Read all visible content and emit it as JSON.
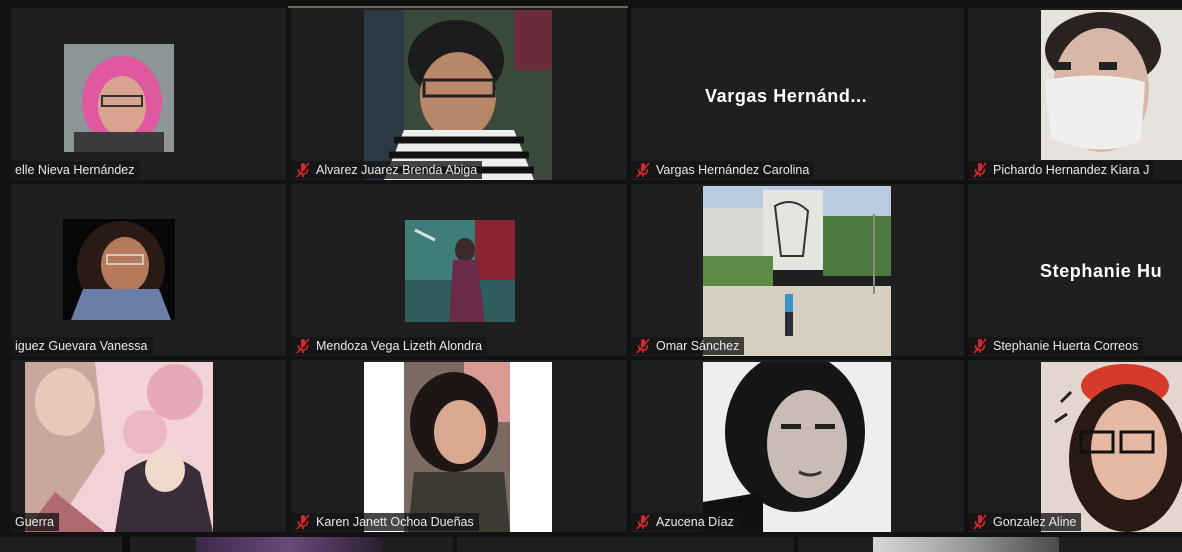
{
  "colors": {
    "background": "#121212",
    "tile": "#1f1f1f",
    "mute_icon": "#d9262f",
    "text": "#ffffff"
  },
  "tiles": [
    {
      "name": "elle Nieva Hernández",
      "muted": false
    },
    {
      "name": "Alvarez Juarez Brenda Abiga",
      "muted": true
    },
    {
      "name": "Vargas Hernández Carolina",
      "muted": true,
      "center": "Vargas Hernánd..."
    },
    {
      "name": "Pichardo Hernandez Kiara J",
      "muted": true
    },
    {
      "name": "iguez Guevara Vanessa",
      "muted": false
    },
    {
      "name": "Mendoza Vega Lizeth Alondra",
      "muted": true
    },
    {
      "name": "Omar Sánchez",
      "muted": true
    },
    {
      "name": "Stephanie Huerta Correos",
      "muted": true,
      "center": "Stephanie Hu"
    },
    {
      "name": "Guerra",
      "muted": false
    },
    {
      "name": "Karen Janett Ochoa Dueñas",
      "muted": true
    },
    {
      "name": "Azucena Díaz",
      "muted": true
    },
    {
      "name": "Gonzalez Aline",
      "muted": true
    }
  ]
}
